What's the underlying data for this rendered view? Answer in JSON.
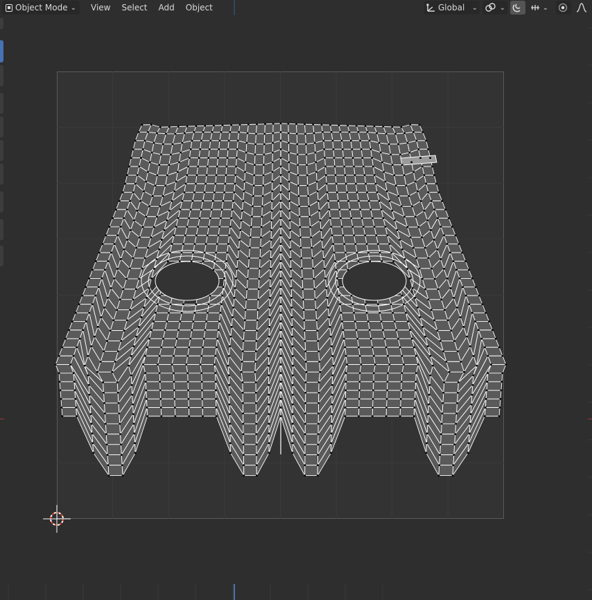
{
  "header": {
    "mode": "Object Mode",
    "menus": [
      "View",
      "Select",
      "Add",
      "Object"
    ],
    "transform_orientation": "Global"
  },
  "icons": {
    "mode": "object-mode-icon",
    "orientation": "transform-orientation-icon",
    "pivot": "pivot-point-icon",
    "snap": "snap-magnet-icon",
    "snap_target": "snap-increment-icon",
    "proportional": "proportional-editing-icon",
    "falloff": "falloff-curve-icon"
  },
  "colors": {
    "background": "#2e2e2e",
    "uv_fill": "#5a5a5a",
    "edge": "#ffffff",
    "vertex": "#000000",
    "cursor_red": "#e8442c"
  }
}
